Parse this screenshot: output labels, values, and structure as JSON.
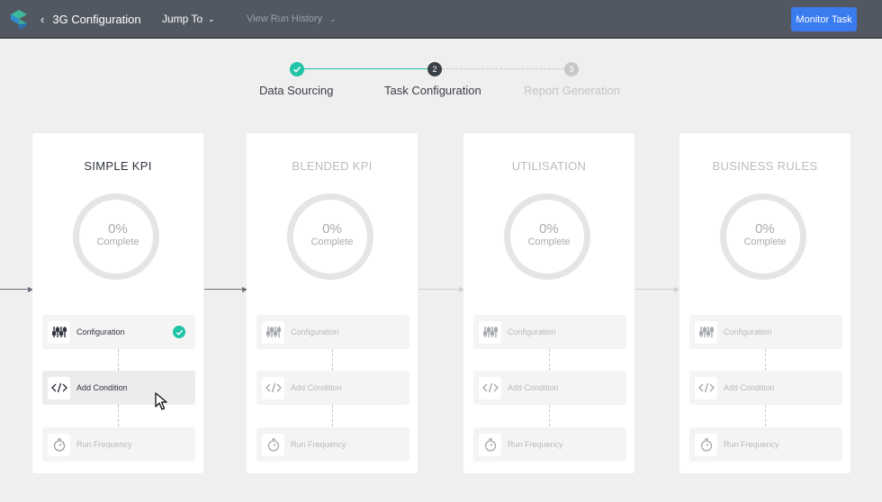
{
  "topbar": {
    "back_label": "3G Configuration",
    "jump_label": "Jump To",
    "history_label": "View Run History",
    "monitor_label": "Monitor Task"
  },
  "stepper": {
    "steps": [
      {
        "number": "1",
        "label": "Data Sourcing",
        "state": "done"
      },
      {
        "number": "2",
        "label": "Task Configuration",
        "state": "current"
      },
      {
        "number": "3",
        "label": "Report Generation",
        "state": "upcoming"
      }
    ]
  },
  "cards": [
    {
      "title": "SIMPLE KPI",
      "percent": "0%",
      "complete_label": "Complete",
      "active": true,
      "tasks": [
        {
          "label": "Configuration",
          "icon": "sliders-icon",
          "done": true
        },
        {
          "label": "Add Condition",
          "icon": "code-icon",
          "done": false
        },
        {
          "label": "Run Frequency",
          "icon": "stopwatch-icon",
          "done": false
        }
      ]
    },
    {
      "title": "BLENDED KPI",
      "percent": "0%",
      "complete_label": "Complete",
      "active": false,
      "tasks": [
        {
          "label": "Configuration",
          "icon": "sliders-icon"
        },
        {
          "label": "Add Condition",
          "icon": "code-icon"
        },
        {
          "label": "Run Frequency",
          "icon": "stopwatch-icon"
        }
      ]
    },
    {
      "title": "UTILISATION",
      "percent": "0%",
      "complete_label": "Complete",
      "active": false,
      "tasks": [
        {
          "label": "Configuration",
          "icon": "sliders-icon"
        },
        {
          "label": "Add Condition",
          "icon": "code-icon"
        },
        {
          "label": "Run Frequency",
          "icon": "stopwatch-icon"
        }
      ]
    },
    {
      "title": "BUSINESS RULES",
      "percent": "0%",
      "complete_label": "Complete",
      "active": false,
      "tasks": [
        {
          "label": "Configuration",
          "icon": "sliders-icon"
        },
        {
          "label": "Add Condition",
          "icon": "code-icon"
        },
        {
          "label": "Run Frequency",
          "icon": "stopwatch-icon"
        }
      ]
    }
  ],
  "colors": {
    "topbar": "#525861",
    "accent": "#3b7bf0",
    "success": "#20c3a6"
  }
}
